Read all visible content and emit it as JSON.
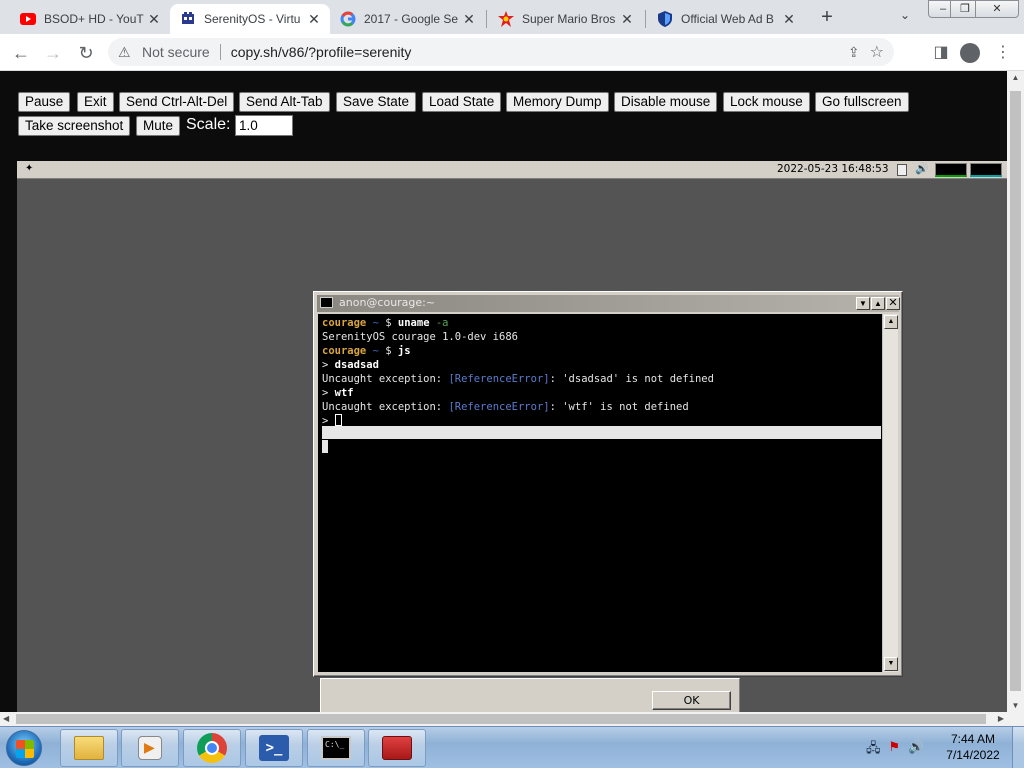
{
  "browser": {
    "tabs": [
      {
        "label": "BSOD+ HD - YouT",
        "icon": "youtube-icon"
      },
      {
        "label": "SerenityOS - Virtu",
        "icon": "serenityos-icon"
      },
      {
        "label": "2017 - Google Se",
        "icon": "google-icon"
      },
      {
        "label": "Super Mario Bros",
        "icon": "mario-icon"
      },
      {
        "label": "Official Web Ad B",
        "icon": "shield-icon"
      }
    ],
    "security_label": "Not secure",
    "url": "copy.sh/v86/?profile=serenity"
  },
  "v86": {
    "buttons": [
      "Pause",
      "Exit",
      "Send Ctrl-Alt-Del",
      "Send Alt-Tab",
      "Save State",
      "Load State",
      "Memory Dump",
      "Disable mouse",
      "Lock mouse",
      "Go fullscreen"
    ],
    "buttons_row2": [
      "Take screenshot",
      "Mute"
    ],
    "scale_label": "Scale:",
    "scale_value": "1.0"
  },
  "serenity": {
    "clock": "2022-05-23 16:48:53",
    "terminal": {
      "title": "anon@courage:~",
      "prompt_host": "courage",
      "tilde": "~",
      "dollar": "$",
      "cmd1": "uname",
      "cmd1_arg": "-a",
      "output1": "SerenityOS courage 1.0-dev i686",
      "cmd2": "js",
      "input1": "dsadsad",
      "exception_prefix": "Uncaught exception: ",
      "error_type": "[ReferenceError]",
      "exception1_rest": ": 'dsadsad' is not defined",
      "input2": "wtf",
      "exception2_rest": ": 'wtf' is not defined",
      "js_prompt": ">"
    },
    "dialog_ok": "OK"
  },
  "windows": {
    "time": "7:44 AM",
    "date": "7/14/2022"
  }
}
